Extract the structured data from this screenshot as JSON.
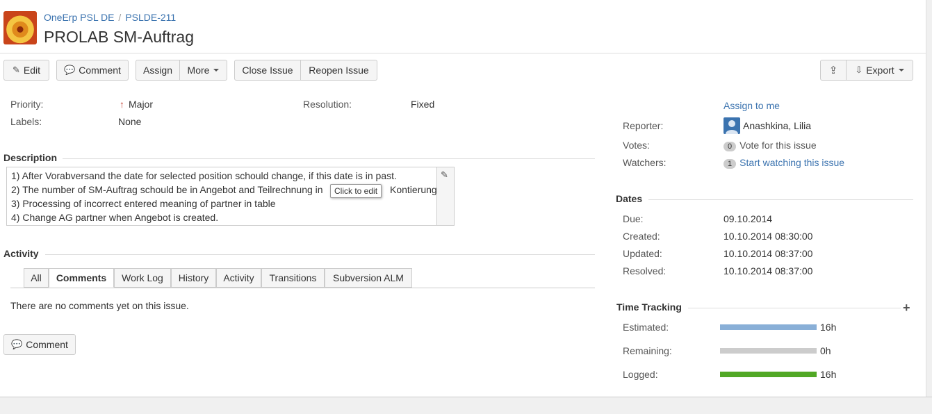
{
  "header": {
    "project": "OneErp PSL DE",
    "separator": "/",
    "issue_key": "PSLDE-211",
    "title": "PROLAB SM-Auftrag"
  },
  "toolbar": {
    "edit": "Edit",
    "comment": "Comment",
    "assign": "Assign",
    "more": "More",
    "close_issue": "Close Issue",
    "reopen_issue": "Reopen Issue",
    "export": "Export"
  },
  "details": {
    "priority_label": "Priority:",
    "priority_value": "Major",
    "resolution_label": "Resolution:",
    "resolution_value": "Fixed",
    "labels_label": "Labels:",
    "labels_value": "None"
  },
  "description": {
    "heading": "Description",
    "lines": [
      "1) After Vorabversand the date for selected position schould change, if this date is in past.",
      "2) The number of SM-Auftrag schould be in Angebot and Teilrechnung in",
      "Kontierung.",
      "3) Processing of incorrect entered meaning of partner in table",
      "4) Change AG partner when Angebot is created."
    ],
    "tooltip": "Click to edit"
  },
  "activity": {
    "heading": "Activity",
    "tabs": [
      "All",
      "Comments",
      "Work Log",
      "History",
      "Activity",
      "Transitions",
      "Subversion ALM"
    ],
    "active_tab": "Comments",
    "empty_message": "There are no comments yet on this issue.",
    "comment_button": "Comment"
  },
  "people": {
    "assign_to_me": "Assign to me",
    "reporter_label": "Reporter:",
    "reporter_value": "Anashkina, Lilia",
    "votes_label": "Votes:",
    "votes_count": "0",
    "votes_link": "Vote for this issue",
    "watchers_label": "Watchers:",
    "watchers_count": "1",
    "watchers_link": "Start watching this issue"
  },
  "dates": {
    "heading": "Dates",
    "due_label": "Due:",
    "due_value": "09.10.2014",
    "created_label": "Created:",
    "created_value": "10.10.2014 08:30:00",
    "updated_label": "Updated:",
    "updated_value": "10.10.2014 08:37:00",
    "resolved_label": "Resolved:",
    "resolved_value": "10.10.2014 08:37:00"
  },
  "time_tracking": {
    "heading": "Time Tracking",
    "estimated_label": "Estimated:",
    "estimated_value": "16h",
    "estimated_fraction": 1.0,
    "remaining_label": "Remaining:",
    "remaining_value": "0h",
    "remaining_fraction": 1.0,
    "logged_label": "Logged:",
    "logged_value": "16h",
    "logged_fraction": 1.0,
    "colors": {
      "estimated": "#89afd7",
      "remaining": "#cccccc",
      "logged": "#51a825"
    }
  },
  "colors": {
    "link": "#3b73af",
    "priority_arrow": "#c0392b"
  },
  "icons": [
    "pencil-icon",
    "speech-bubble-icon",
    "share-icon",
    "export-icon",
    "plus-icon",
    "up-arrow-icon",
    "user-icon"
  ]
}
